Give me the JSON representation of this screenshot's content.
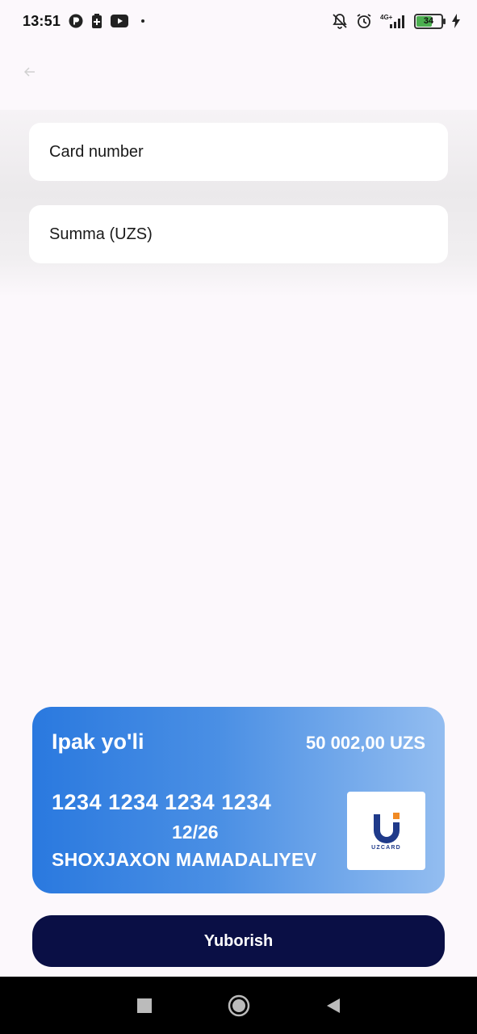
{
  "status_bar": {
    "time": "13:51",
    "battery_level": "34",
    "icons": [
      "p-app-icon",
      "battery-saver-icon",
      "youtube-icon",
      "dot-icon",
      "bell-off-icon",
      "alarm-icon",
      "signal-4g-icon",
      "battery-icon",
      "charging-icon"
    ]
  },
  "form": {
    "card_number_placeholder": "Card number",
    "summa_placeholder": "Summa (UZS)"
  },
  "card": {
    "bank_name": "Ipak yo'li",
    "balance": "50 002,00 UZS",
    "number": "1234 1234 1234 1234",
    "expiry": "12/26",
    "holder": "SHOXJAXON MAMADALIYEV",
    "logo_text": "UZCARD"
  },
  "actions": {
    "send_label": "Yuborish"
  },
  "colors": {
    "accent_dark": "#0a0f45",
    "card_gradient_start": "#2a79df",
    "card_gradient_end": "#93bdf0"
  }
}
